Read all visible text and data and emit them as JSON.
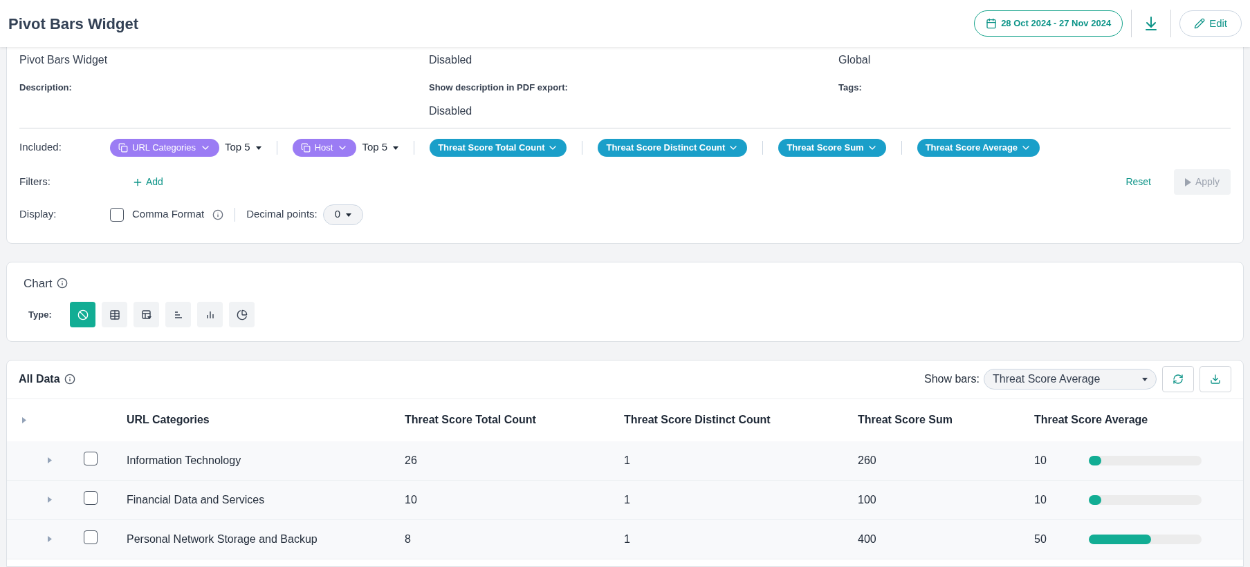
{
  "header": {
    "title": "Pivot Bars Widget",
    "date_range": "28 Oct 2024 - 27 Nov 2024",
    "edit_label": "Edit"
  },
  "details": {
    "fields": [
      {
        "value": "Pivot Bars Widget"
      },
      {
        "value": "Disabled"
      },
      {
        "value": "Global"
      },
      {
        "label": "Description:"
      },
      {
        "label": "Show description in PDF export:",
        "value": "Disabled"
      },
      {
        "label": "Tags:"
      }
    ],
    "included_label": "Included:",
    "included": [
      {
        "kind": "dimension",
        "label": "URL Categories",
        "limit": "Top 5"
      },
      {
        "kind": "dimension",
        "label": "Host",
        "limit": "Top 5"
      },
      {
        "kind": "measure",
        "label": "Threat Score Total Count"
      },
      {
        "kind": "measure",
        "label": "Threat Score Distinct Count"
      },
      {
        "kind": "measure",
        "label": "Threat Score Sum"
      },
      {
        "kind": "measure",
        "label": "Threat Score Average"
      }
    ],
    "filters_label": "Filters:",
    "add_label": "Add",
    "reset_label": "Reset",
    "apply": {
      "label": "Apply",
      "disabled": true
    },
    "display_label": "Display:",
    "comma_format": {
      "label": "Comma Format",
      "checked": false
    },
    "decimal_label": "Decimal points:",
    "decimal_value": "0"
  },
  "chart": {
    "title": "Chart",
    "type_label": "Type:",
    "types": [
      {
        "kind": "none",
        "selected": true
      },
      {
        "kind": "table",
        "selected": false
      },
      {
        "kind": "pivot",
        "selected": false
      },
      {
        "kind": "hbar",
        "selected": false
      },
      {
        "kind": "vbar",
        "selected": false
      },
      {
        "kind": "pie",
        "selected": false
      }
    ]
  },
  "all_data": {
    "title": "All Data",
    "show_bars_label": "Show bars:",
    "show_bars_value": "Threat Score Average",
    "columns": [
      "URL Categories",
      "Threat Score Total Count",
      "Threat Score Distinct Count",
      "Threat Score Sum",
      "Threat Score Average"
    ],
    "rows": [
      {
        "category": "Information Technology",
        "total": "26",
        "distinct": "1",
        "sum": "260",
        "average": "10",
        "level": 0.11,
        "checked": false
      },
      {
        "category": "Financial Data and Services",
        "total": "10",
        "distinct": "1",
        "sum": "100",
        "average": "10",
        "level": 0.11,
        "checked": false
      },
      {
        "category": "Personal Network Storage and Backup",
        "total": "8",
        "distinct": "1",
        "sum": "400",
        "average": "50",
        "level": 0.55,
        "checked": false
      }
    ]
  }
}
